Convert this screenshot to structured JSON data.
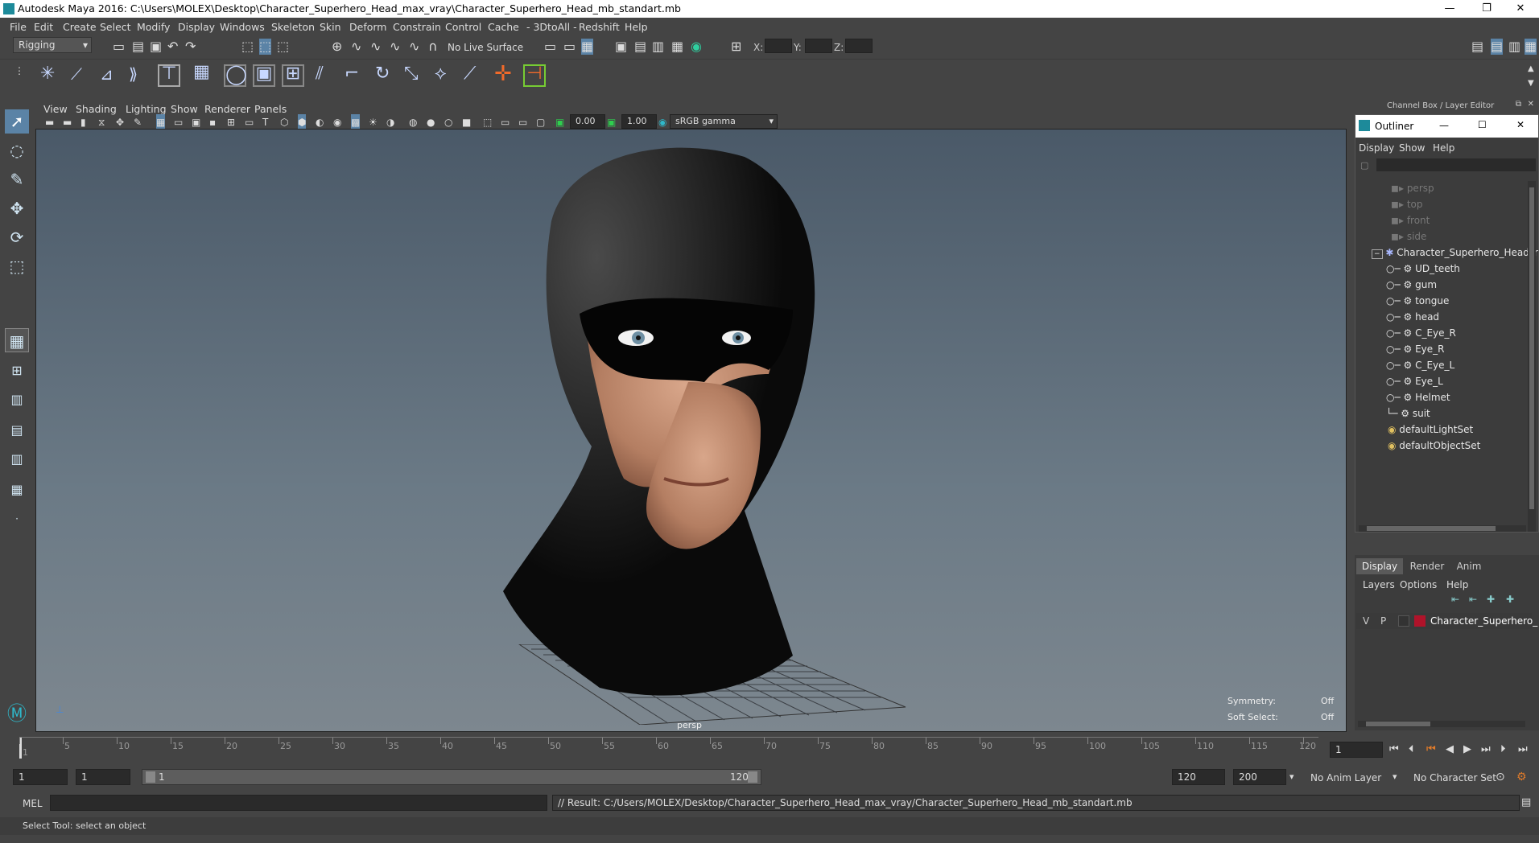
{
  "titlebar": {
    "title": "Autodesk Maya 2016: C:\\Users\\MOLEX\\Desktop\\Character_Superhero_Head_max_vray\\Character_Superhero_Head_mb_standart.mb",
    "minimize": "—",
    "restore": "❐",
    "close": "✕"
  },
  "menubar": {
    "items": [
      "File",
      "Edit",
      "Create",
      "Select",
      "Modify",
      "Display",
      "Windows",
      "Skeleton",
      "Skin",
      "Deform",
      "Constrain",
      "Control",
      "Cache",
      "- 3DtoAll -",
      "Redshift",
      "Help"
    ]
  },
  "shelf": {
    "mode": "Rigging",
    "live_surface": "No Live Surface",
    "x_label": "X:",
    "y_label": "Y:",
    "z_label": "Z:"
  },
  "viewport": {
    "menus": [
      "View",
      "Shading",
      "Lighting",
      "Show",
      "Renderer",
      "Panels"
    ],
    "near_value": "0.00",
    "far_value": "1.00",
    "color_space": "sRGB gamma",
    "camera_label": "persp",
    "symmetry_label": "Symmetry:",
    "symmetry_value": "Off",
    "soft_select_label": "Soft Select:",
    "soft_select_value": "Off"
  },
  "channel_box": {
    "title": "Channel Box / Layer Editor"
  },
  "outliner": {
    "title": "Outliner",
    "menus": [
      "Display",
      "Show",
      "Help"
    ],
    "cameras": [
      "persp",
      "top",
      "front",
      "side"
    ],
    "root": "Character_Superhero_Head_r",
    "children": [
      "UD_teeth",
      "gum",
      "tongue",
      "head",
      "C_Eye_R",
      "Eye_R",
      "C_Eye_L",
      "Eye_L",
      "Helmet",
      "suit"
    ],
    "sets": [
      "defaultLightSet",
      "defaultObjectSet"
    ]
  },
  "layers": {
    "tabs": [
      "Display",
      "Render",
      "Anim"
    ],
    "menus": [
      "Layers",
      "Options",
      "Help"
    ],
    "v": "V",
    "p": "P",
    "layer_name": "Character_Superhero_",
    "layer_color": "#b0132a"
  },
  "timeline": {
    "ticks": [
      1,
      5,
      10,
      15,
      20,
      25,
      30,
      35,
      40,
      45,
      50,
      55,
      60,
      65,
      70,
      75,
      80,
      85,
      90,
      95,
      100,
      105,
      110,
      115,
      120
    ],
    "current_frame": "1"
  },
  "range": {
    "start": "1",
    "playback_start": "1",
    "slider_start": "1",
    "slider_end": "120",
    "playback_end": "120",
    "end": "200",
    "anim_layer": "No Anim Layer",
    "character_set": "No Character Set"
  },
  "cmdline": {
    "lang": "MEL",
    "result": "// Result: C:/Users/MOLEX/Desktop/Character_Superhero_Head_max_vray/Character_Superhero_Head_mb_standart.mb"
  },
  "helpline": {
    "text": "Select Tool: select an object"
  }
}
